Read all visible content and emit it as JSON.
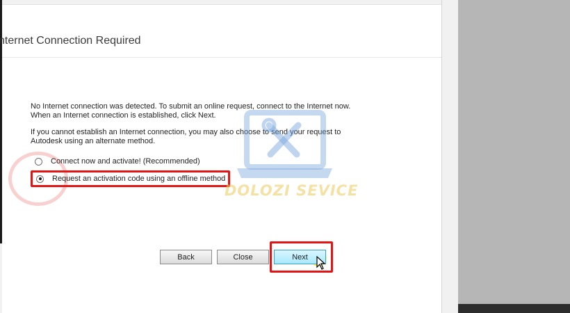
{
  "dialog": {
    "title": "nternet Connection Required",
    "message1_line1": "No Internet connection was detected. To submit an online request, connect to the Internet now.",
    "message1_line2": "When an Internet connection is established, click Next.",
    "message2_line1": "If you cannot establish an Internet connection, you may also choose to send your request to",
    "message2_line2": "Autodesk using an alternate method.",
    "options": [
      {
        "label": "Connect now and activate! (Recommended)",
        "selected": false
      },
      {
        "label": "Request an activation code using an offline method",
        "selected": true
      }
    ],
    "buttons": {
      "back": "Back",
      "close": "Close",
      "next": "Next"
    }
  },
  "watermark": {
    "text": "DOLOZI SEVICE"
  },
  "colors": {
    "highlight": "#e11515",
    "next_button": "#a9e8fb"
  }
}
